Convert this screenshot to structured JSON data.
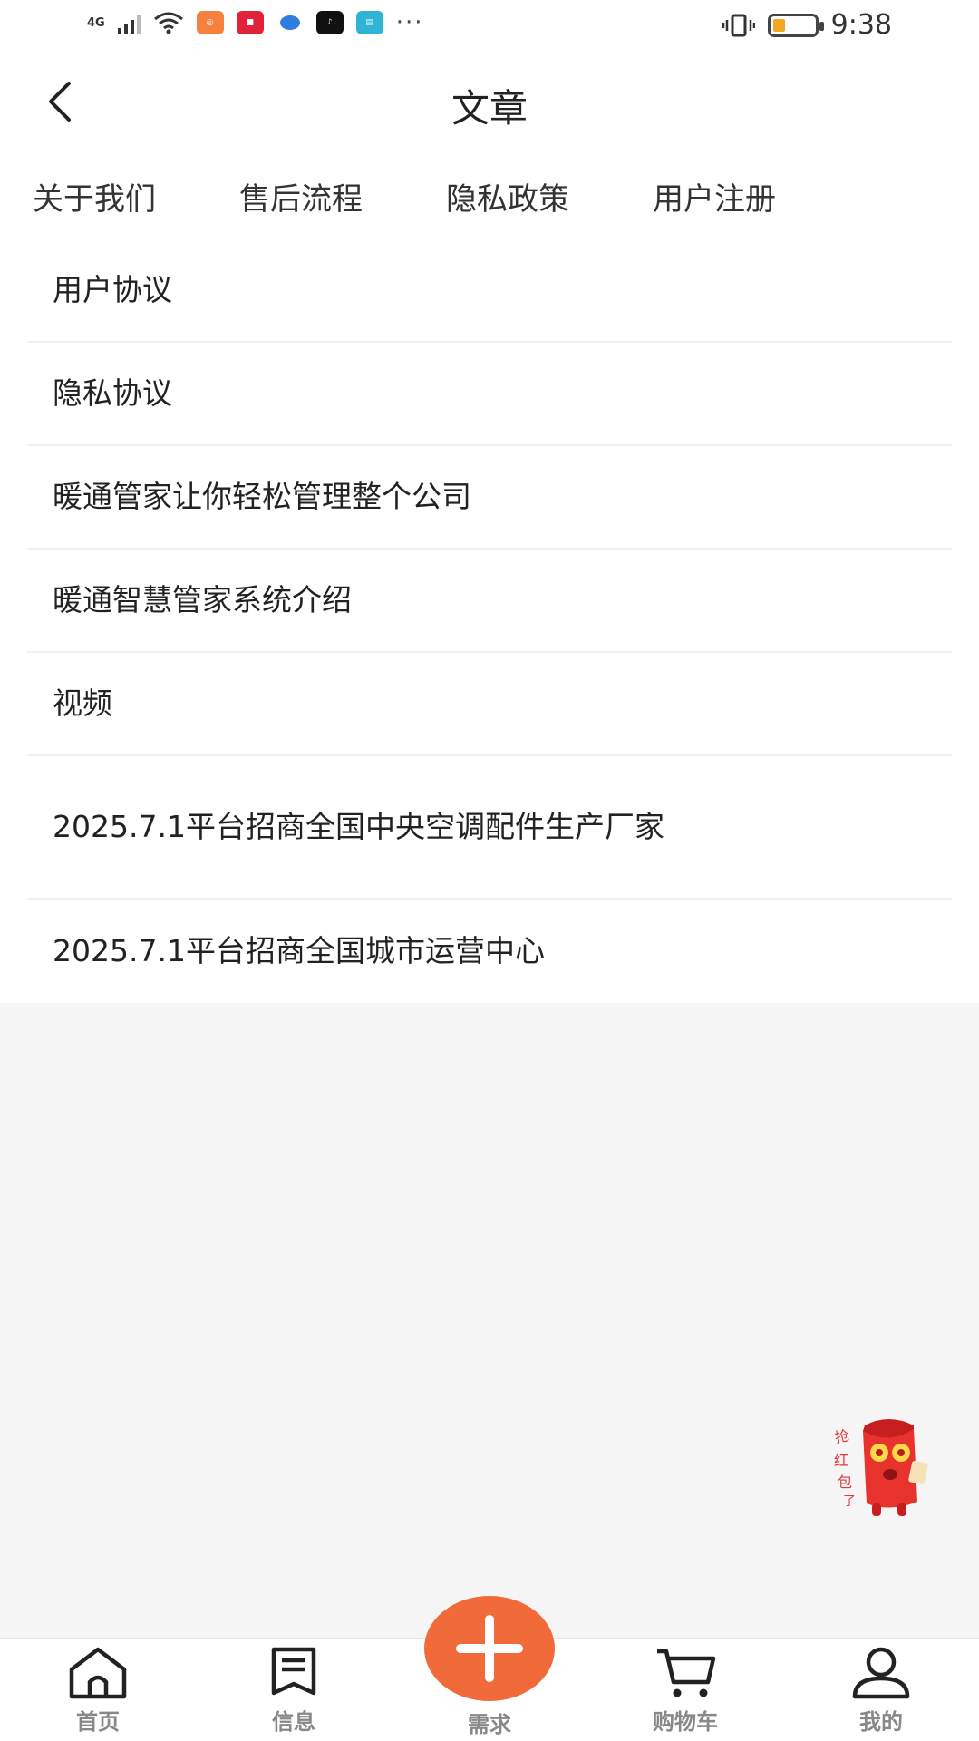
{
  "status_bar": {
    "network": "4G",
    "time": "9:38",
    "battery_color": "#f5a623"
  },
  "header": {
    "title": "文章",
    "back_icon": "chevron-left-icon"
  },
  "tabs": [
    {
      "label": "关于我们"
    },
    {
      "label": "售后流程"
    },
    {
      "label": "隐私政策"
    },
    {
      "label": "用户注册"
    }
  ],
  "articles": [
    {
      "title": "用户协议"
    },
    {
      "title": "隐私协议"
    },
    {
      "title": "暖通管家让你轻松管理整个公司"
    },
    {
      "title": "暖通智慧管家系统介绍"
    },
    {
      "title": "视频"
    },
    {
      "title": "2025.7.1平台招商全国中央空调配件生产厂家"
    },
    {
      "title": "2025.7.1平台招商全国城市运营中心"
    }
  ],
  "promo": {
    "label": "抢红包了",
    "icon": "red-packet-mascot-icon"
  },
  "bottom_nav": {
    "home": "首页",
    "messages": "信息",
    "publish": "需求",
    "cart": "购物车",
    "mine": "我的",
    "accent": "#f06a3a"
  }
}
